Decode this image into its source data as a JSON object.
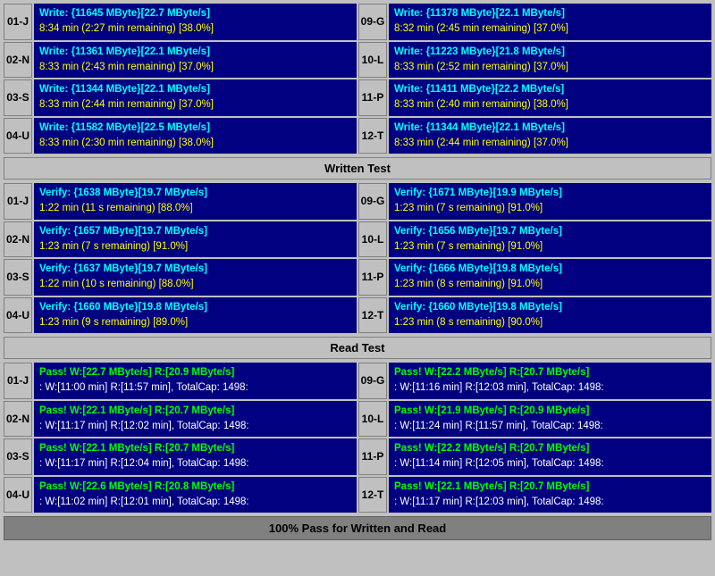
{
  "sections": {
    "written_test_label": "Written Test",
    "read_test_label": "Read Test",
    "bottom_status": "100% Pass for Written and Read"
  },
  "write_rows": [
    {
      "id_left": "01-J",
      "left_line1": "Write: {11645 MByte}[22.7 MByte/s]",
      "left_line2": "8:34 min (2:27 min remaining)  [38.0%]",
      "id_right": "09-G",
      "right_line1": "Write: {11378 MByte}[22.1 MByte/s]",
      "right_line2": "8:32 min (2:45 min remaining)  [37.0%]"
    },
    {
      "id_left": "02-N",
      "left_line1": "Write: {11361 MByte}[22.1 MByte/s]",
      "left_line2": "8:33 min (2:43 min remaining)  [37.0%]",
      "id_right": "10-L",
      "right_line1": "Write: {11223 MByte}[21.8 MByte/s]",
      "right_line2": "8:33 min (2:52 min remaining)  [37.0%]"
    },
    {
      "id_left": "03-S",
      "left_line1": "Write: {11344 MByte}[22.1 MByte/s]",
      "left_line2": "8:33 min (2:44 min remaining)  [37.0%]",
      "id_right": "11-P",
      "right_line1": "Write: {11411 MByte}[22.2 MByte/s]",
      "right_line2": "8:33 min (2:40 min remaining)  [38.0%]"
    },
    {
      "id_left": "04-U",
      "left_line1": "Write: {11582 MByte}[22.5 MByte/s]",
      "left_line2": "8:33 min (2:30 min remaining)  [38.0%]",
      "id_right": "12-T",
      "right_line1": "Write: {11344 MByte}[22.1 MByte/s]",
      "right_line2": "8:33 min (2:44 min remaining)  [37.0%]"
    }
  ],
  "verify_rows": [
    {
      "id_left": "01-J",
      "left_line1": "Verify: {1638 MByte}[19.7 MByte/s]",
      "left_line2": "1:22 min (11 s remaining)   [88.0%]",
      "id_right": "09-G",
      "right_line1": "Verify: {1671 MByte}[19.9 MByte/s]",
      "right_line2": "1:23 min (7 s remaining)   [91.0%]"
    },
    {
      "id_left": "02-N",
      "left_line1": "Verify: {1657 MByte}[19.7 MByte/s]",
      "left_line2": "1:23 min (7 s remaining)   [91.0%]",
      "id_right": "10-L",
      "right_line1": "Verify: {1656 MByte}[19.7 MByte/s]",
      "right_line2": "1:23 min (7 s remaining)   [91.0%]"
    },
    {
      "id_left": "03-S",
      "left_line1": "Verify: {1637 MByte}[19.7 MByte/s]",
      "left_line2": "1:22 min (10 s remaining)   [88.0%]",
      "id_right": "11-P",
      "right_line1": "Verify: {1666 MByte}[19.8 MByte/s]",
      "right_line2": "1:23 min (8 s remaining)   [91.0%]"
    },
    {
      "id_left": "04-U",
      "left_line1": "Verify: {1660 MByte}[19.8 MByte/s]",
      "left_line2": "1:23 min (9 s remaining)   [89.0%]",
      "id_right": "12-T",
      "right_line1": "Verify: {1660 MByte}[19.8 MByte/s]",
      "right_line2": "1:23 min (8 s remaining)   [90.0%]"
    }
  ],
  "read_rows": [
    {
      "id_left": "01-J",
      "left_line1": "Pass! W:[22.7 MByte/s] R:[20.9 MByte/s]",
      "left_line2": ": W:[11:00 min] R:[11:57 min], TotalCap: 1498:",
      "id_right": "09-G",
      "right_line1": "Pass! W:[22.2 MByte/s] R:[20.7 MByte/s]",
      "right_line2": ": W:[11:16 min] R:[12:03 min], TotalCap: 1498:"
    },
    {
      "id_left": "02-N",
      "left_line1": "Pass! W:[22.1 MByte/s] R:[20.7 MByte/s]",
      "left_line2": ": W:[11:17 min] R:[12:02 min], TotalCap: 1498:",
      "id_right": "10-L",
      "right_line1": "Pass! W:[21.9 MByte/s] R:[20.9 MByte/s]",
      "right_line2": ": W:[11:24 min] R:[11:57 min], TotalCap: 1498:"
    },
    {
      "id_left": "03-S",
      "left_line1": "Pass! W:[22.1 MByte/s] R:[20.7 MByte/s]",
      "left_line2": ": W:[11:17 min] R:[12:04 min], TotalCap: 1498:",
      "id_right": "11-P",
      "right_line1": "Pass! W:[22.2 MByte/s] R:[20.7 MByte/s]",
      "right_line2": ": W:[11:14 min] R:[12:05 min], TotalCap: 1498:"
    },
    {
      "id_left": "04-U",
      "left_line1": "Pass! W:[22.6 MByte/s] R:[20.8 MByte/s]",
      "left_line2": ": W:[11:02 min] R:[12:01 min], TotalCap: 1498:",
      "id_right": "12-T",
      "right_line1": "Pass! W:[22.1 MByte/s] R:[20.7 MByte/s]",
      "right_line2": ": W:[11:17 min] R:[12:03 min], TotalCap: 1498:"
    }
  ]
}
